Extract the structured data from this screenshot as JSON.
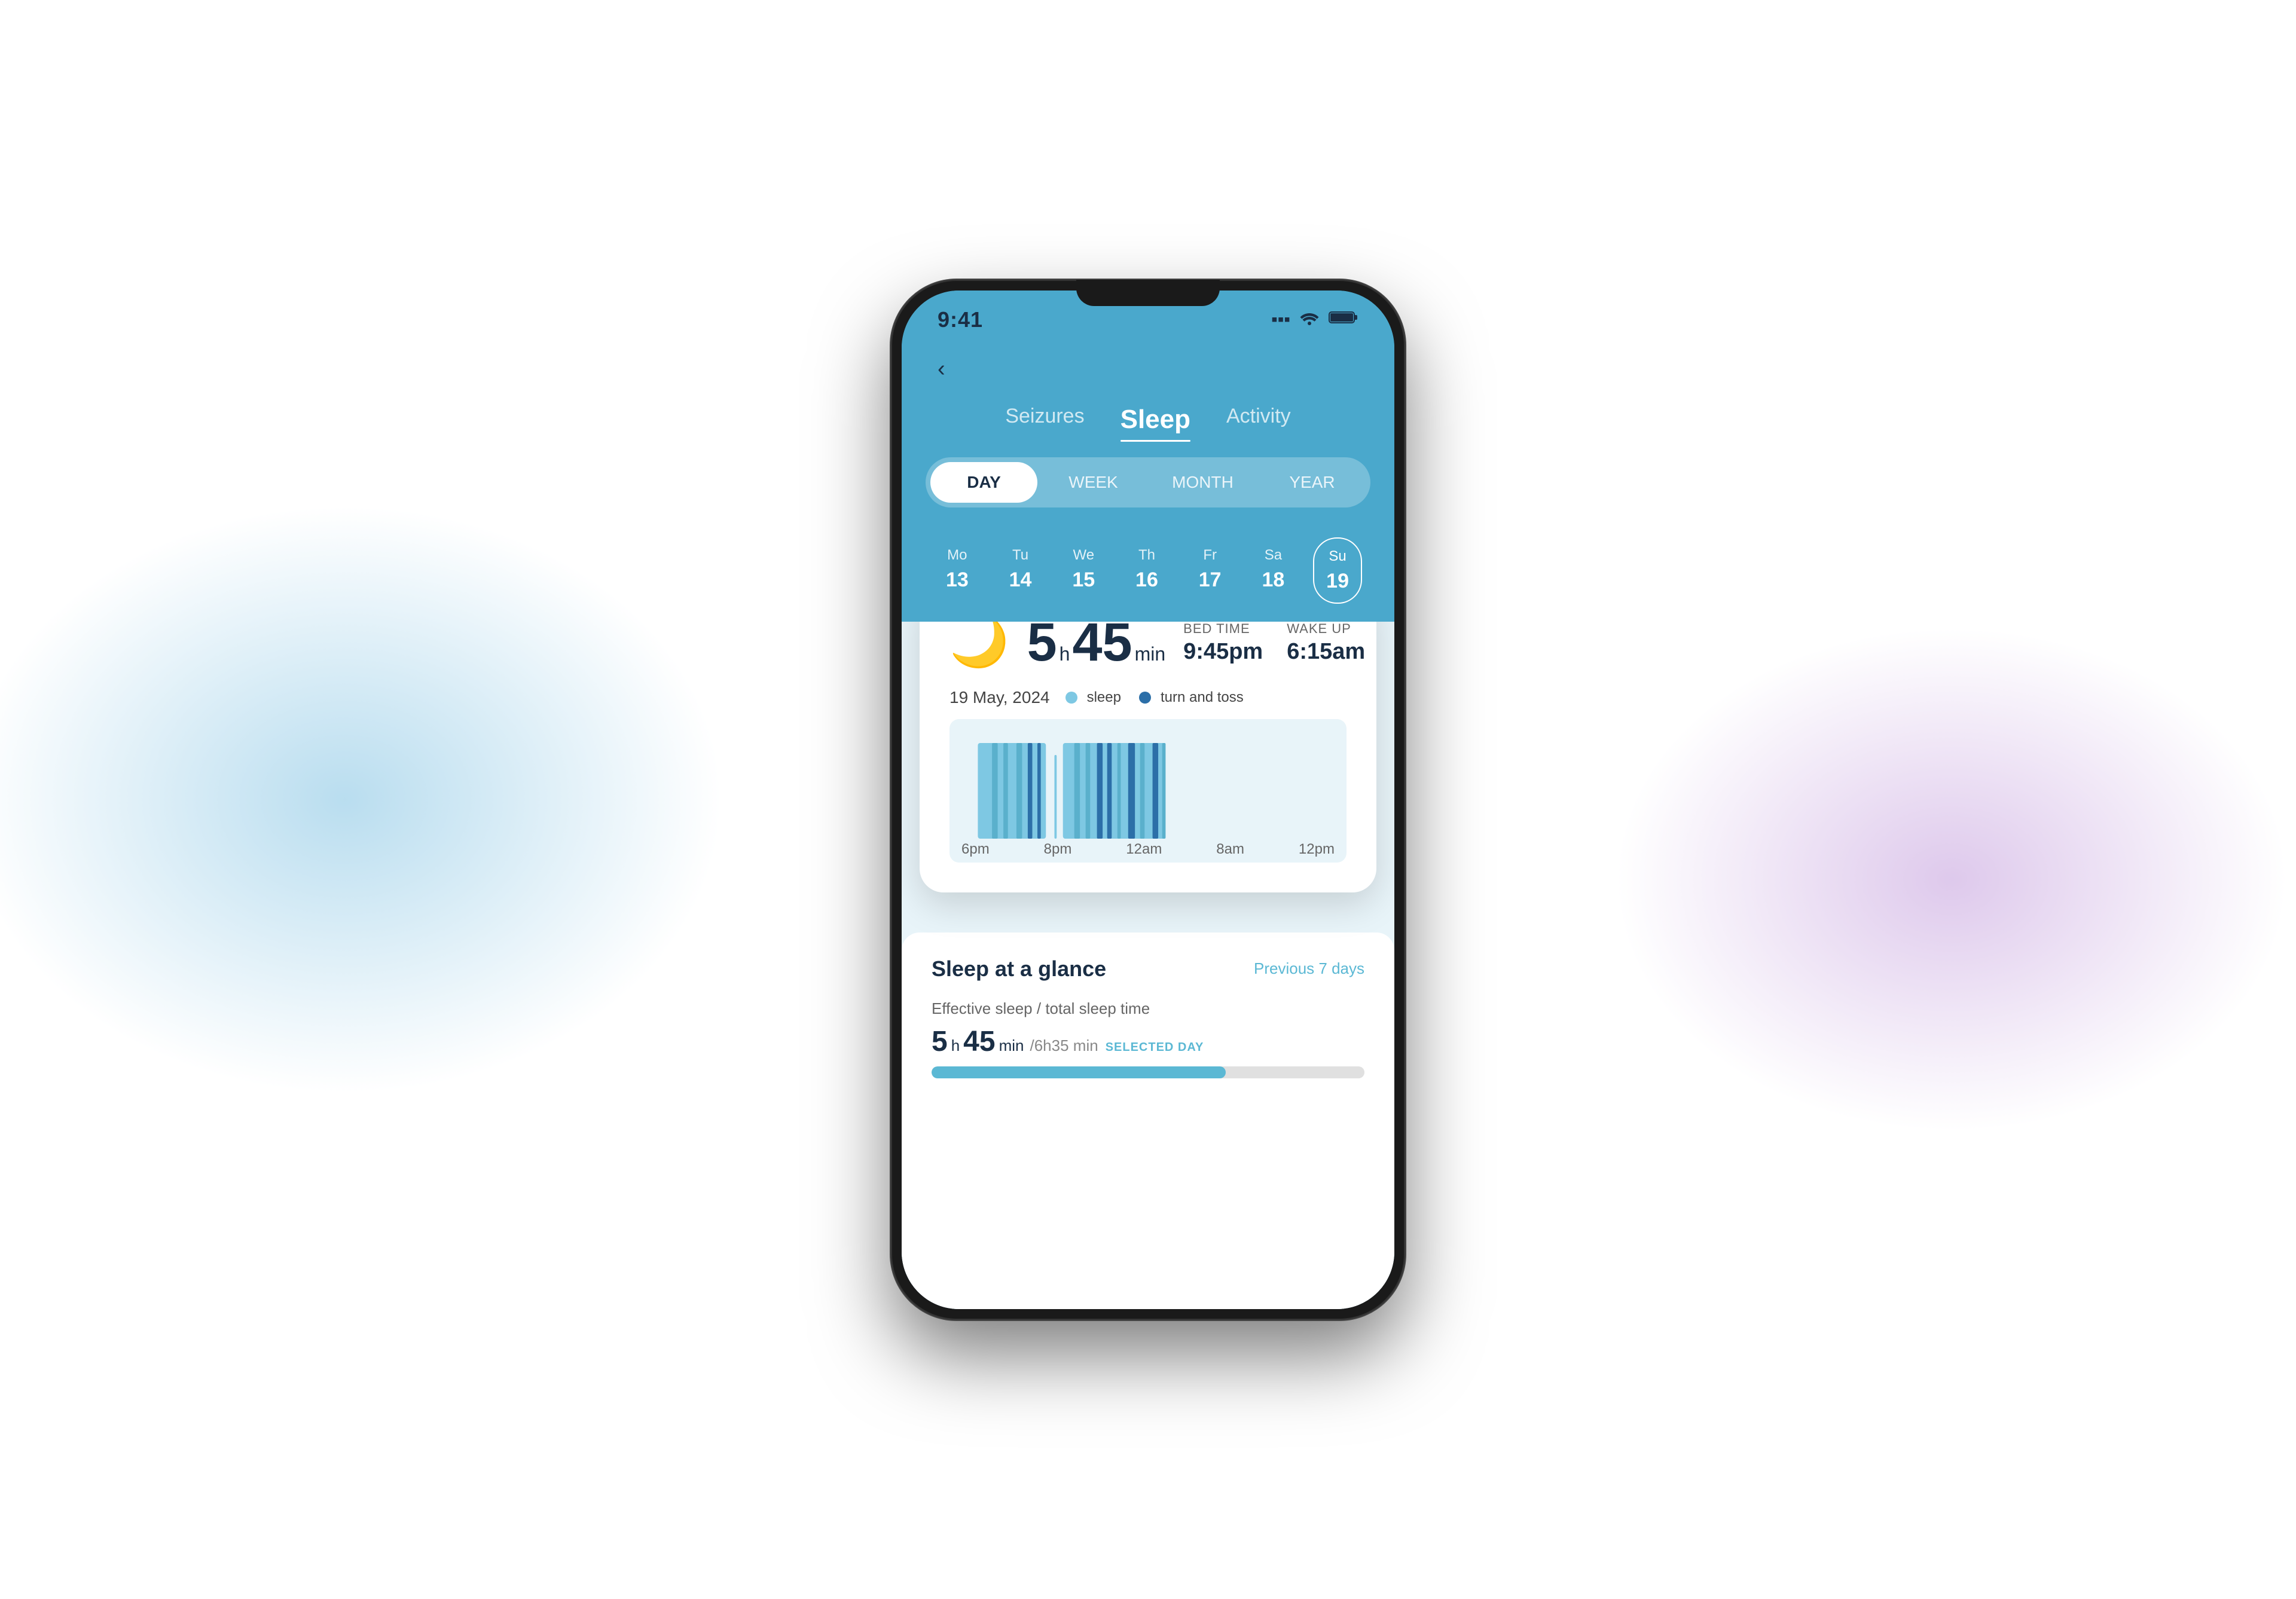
{
  "background": {
    "color_left": "rgba(100,180,220,0.45)",
    "color_right": "rgba(160,100,200,0.35)"
  },
  "status_bar": {
    "time": "9:41",
    "signal_icon": "▪▪▪",
    "wifi_icon": "WiFi",
    "battery_icon": "🔋"
  },
  "header": {
    "back_label": "‹",
    "tabs": [
      {
        "label": "Seizures",
        "active": false
      },
      {
        "label": "Sleep",
        "active": true
      },
      {
        "label": "Activity",
        "active": false
      }
    ]
  },
  "period_selector": {
    "options": [
      {
        "label": "DAY",
        "active": true
      },
      {
        "label": "WEEK",
        "active": false
      },
      {
        "label": "MONTH",
        "active": false
      },
      {
        "label": "YEAR",
        "active": false
      }
    ]
  },
  "day_selector": {
    "days": [
      {
        "name": "Mo",
        "num": "13",
        "selected": false
      },
      {
        "name": "Tu",
        "num": "14",
        "selected": false
      },
      {
        "name": "We",
        "num": "15",
        "selected": false
      },
      {
        "name": "Th",
        "num": "16",
        "selected": false
      },
      {
        "name": "Fr",
        "num": "17",
        "selected": false
      },
      {
        "name": "Sa",
        "num": "18",
        "selected": false
      },
      {
        "name": "Su",
        "num": "19",
        "selected": true
      }
    ]
  },
  "sleep_card": {
    "duration_hours": "5",
    "duration_hours_unit": "h",
    "duration_mins": "45",
    "duration_mins_unit": "min",
    "bed_time_label": "BED TIME",
    "bed_time_value": "9:45pm",
    "wake_up_label": "WAKE UP",
    "wake_up_value": "6:15am",
    "date": "19 May, 2024",
    "legend": [
      {
        "label": "sleep",
        "color": "#7ec8e3"
      },
      {
        "label": "turn and toss",
        "color": "#2c6fa8"
      }
    ],
    "chart_labels": [
      "6pm",
      "8pm",
      "12am",
      "8am",
      "12pm"
    ]
  },
  "sleep_at_glance": {
    "title": "Sleep at a glance",
    "period_label": "Previous 7 days",
    "effective_sleep_label": "Effective sleep",
    "total_sleep_label": "total sleep time",
    "stat_main_hours": "5",
    "stat_main_hours_unit": "h",
    "stat_main_mins": "45",
    "stat_main_mins_unit": "min",
    "stat_secondary": "/6h35",
    "stat_secondary_unit": "min",
    "badge": "SELECTED DAY",
    "progress_percent": 68
  }
}
